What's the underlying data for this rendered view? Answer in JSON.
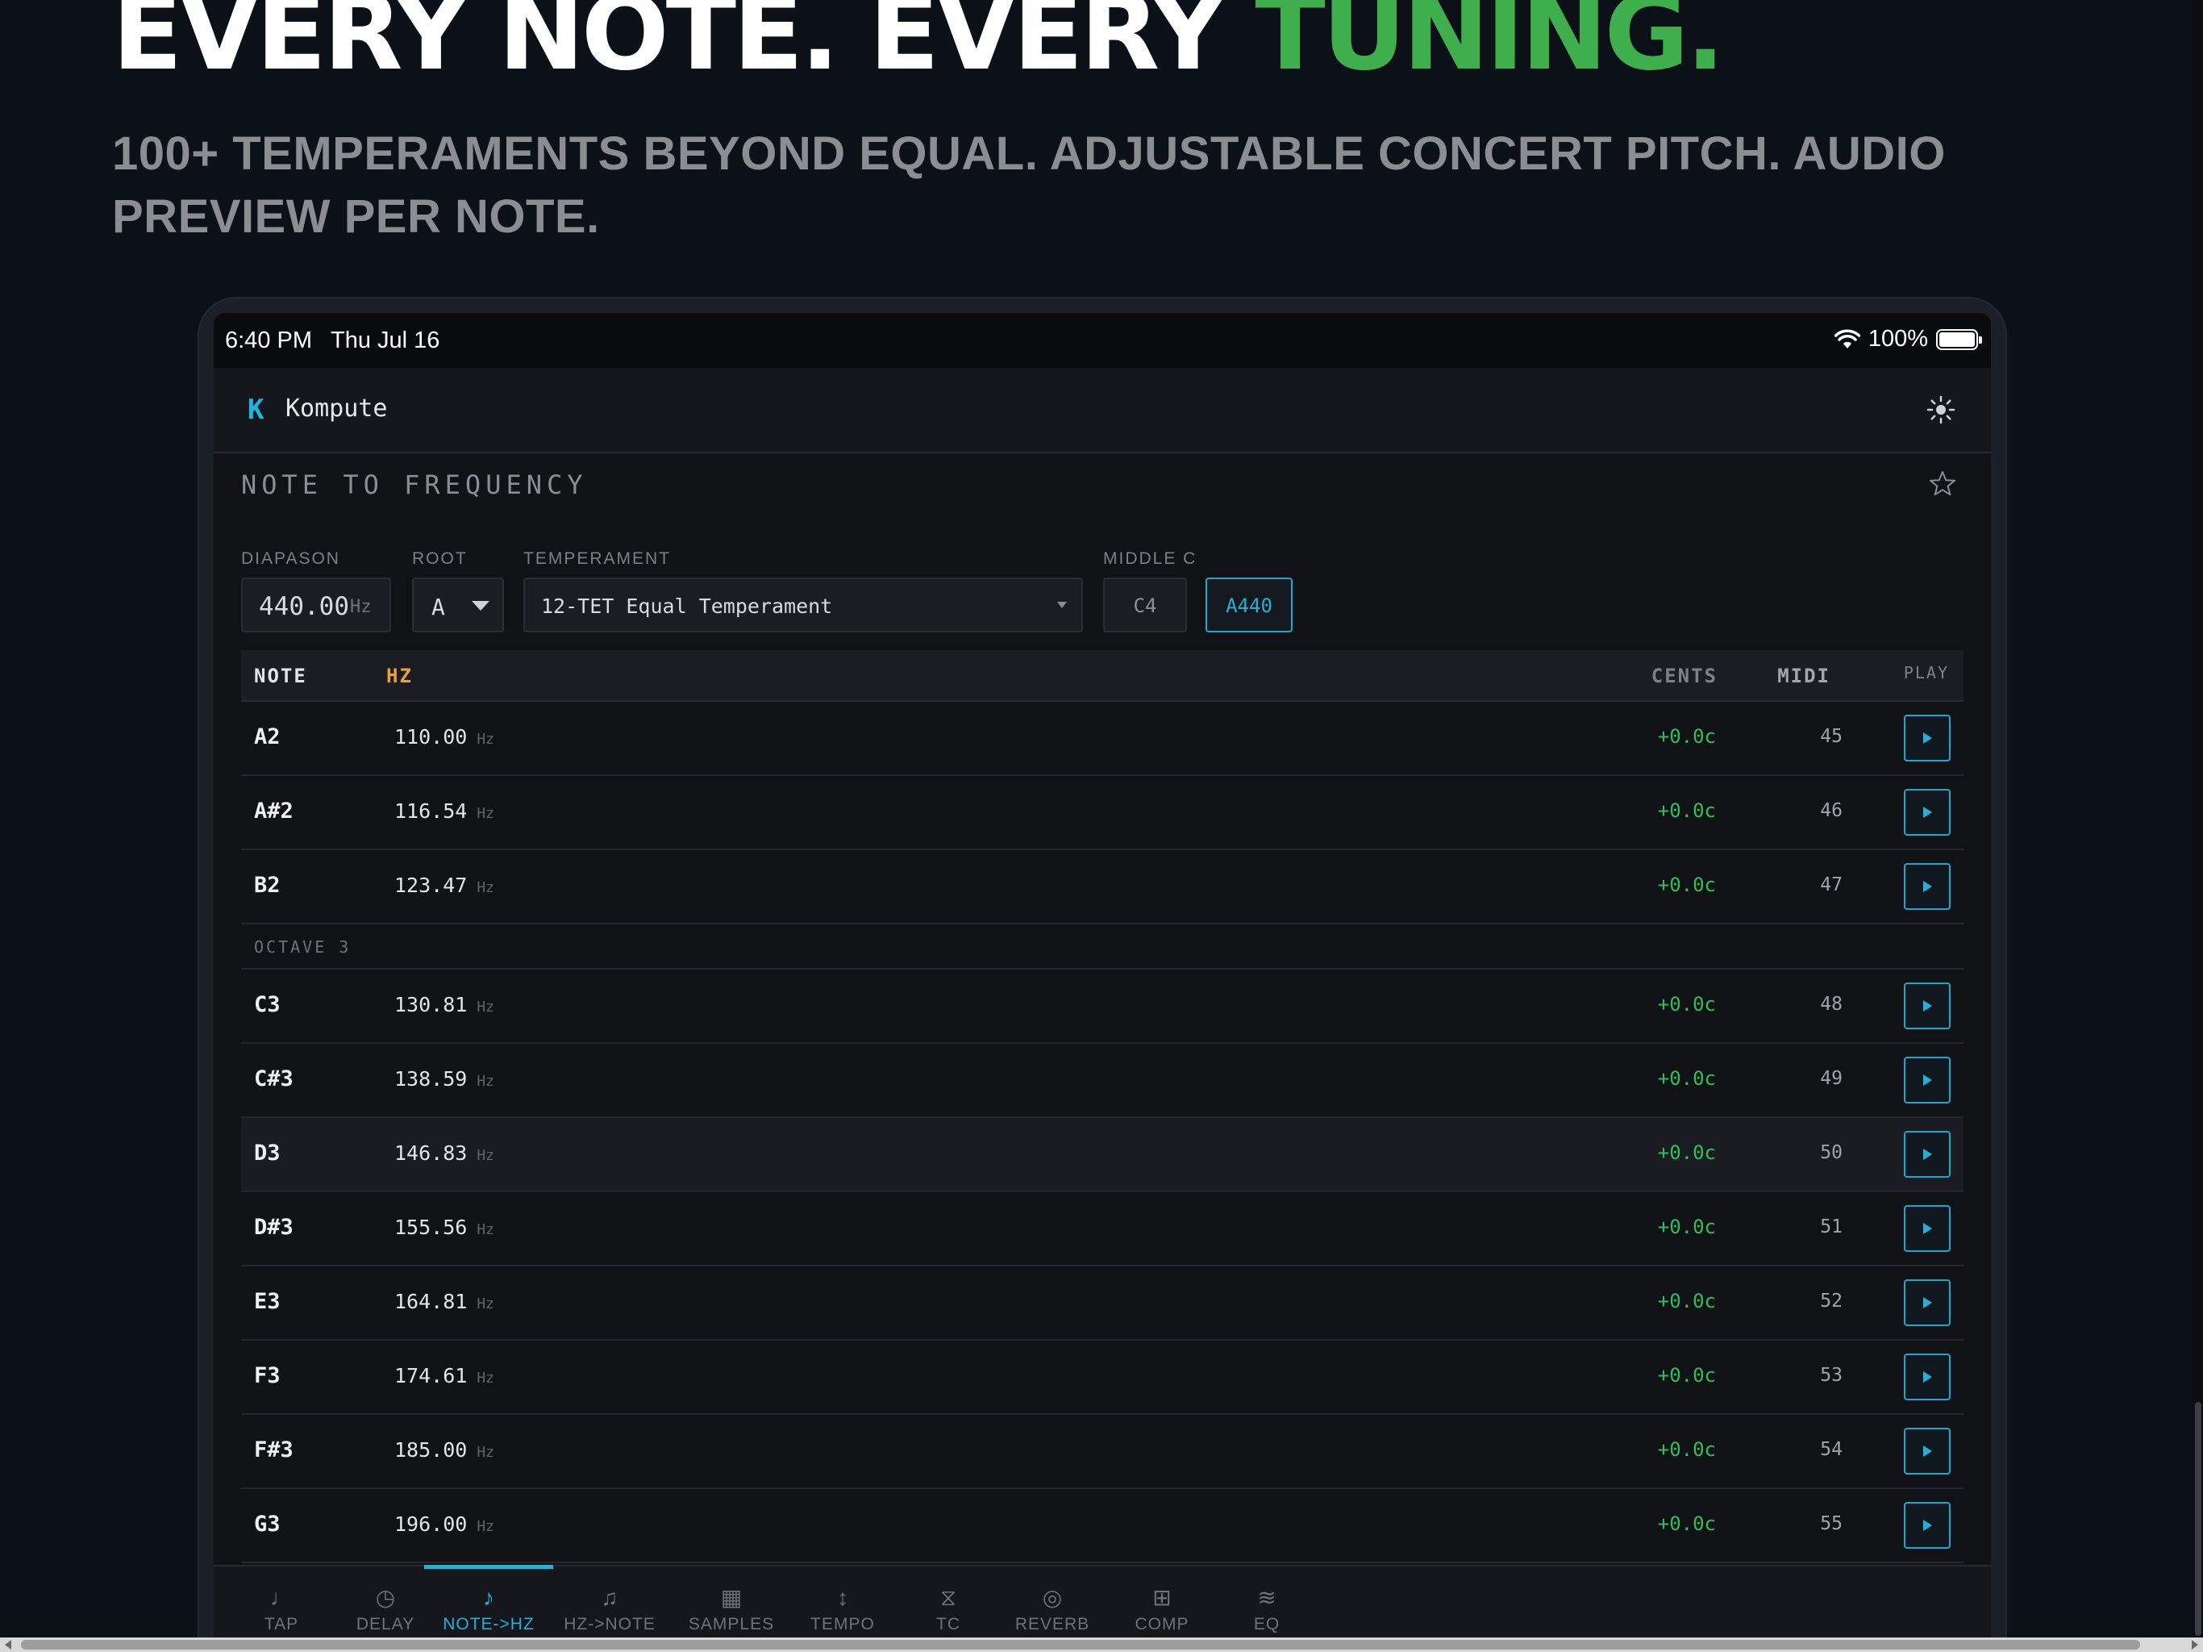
{
  "hero": {
    "title_main": "EVERY NOTE. EVERY ",
    "title_accent": "TUNING.",
    "subtitle": "100+ TEMPERAMENTS BEYOND EQUAL. ADJUSTABLE CONCERT PITCH. AUDIO PREVIEW PER NOTE."
  },
  "status": {
    "time": "6:40 PM",
    "date": "Thu Jul 16",
    "battery": "100%"
  },
  "app": {
    "logo": "K",
    "name": "Kompute",
    "theme_icon": "sun-icon"
  },
  "section": {
    "title": "NOTE TO FREQUENCY",
    "favorite_icon": "star-icon"
  },
  "controls": {
    "diapason_label": "DIAPASON",
    "diapason_value": "440.00",
    "diapason_unit": "Hz",
    "root_label": "ROOT",
    "root_value": "A",
    "temperament_label": "TEMPERAMENT",
    "temperament_value": "12-TET Equal Temperament",
    "middle_c_label": "MIDDLE C",
    "middle_c_option": "C4",
    "a440_option": "A440"
  },
  "table": {
    "headers": {
      "note": "NOTE",
      "hz": "HZ",
      "cents": "CENTS",
      "midi": "MIDI",
      "play": "PLAY"
    },
    "unit": "Hz",
    "rows_top": [
      {
        "note": "A2",
        "hz": "110.00",
        "cents": "+0.0c",
        "midi": "45"
      },
      {
        "note": "A#2",
        "hz": "116.54",
        "cents": "+0.0c",
        "midi": "46"
      },
      {
        "note": "B2",
        "hz": "123.47",
        "cents": "+0.0c",
        "midi": "47"
      }
    ],
    "octave_label": "OCTAVE 3",
    "rows_octave": [
      {
        "note": "C3",
        "hz": "130.81",
        "cents": "+0.0c",
        "midi": "48"
      },
      {
        "note": "C#3",
        "hz": "138.59",
        "cents": "+0.0c",
        "midi": "49"
      },
      {
        "note": "D3",
        "hz": "146.83",
        "cents": "+0.0c",
        "midi": "50"
      },
      {
        "note": "D#3",
        "hz": "155.56",
        "cents": "+0.0c",
        "midi": "51"
      },
      {
        "note": "E3",
        "hz": "164.81",
        "cents": "+0.0c",
        "midi": "52"
      },
      {
        "note": "F3",
        "hz": "174.61",
        "cents": "+0.0c",
        "midi": "53"
      },
      {
        "note": "F#3",
        "hz": "185.00",
        "cents": "+0.0c",
        "midi": "54"
      },
      {
        "note": "G3",
        "hz": "196.00",
        "cents": "+0.0c",
        "midi": "55"
      }
    ]
  },
  "tabs": [
    {
      "label": "TAP",
      "icon": "♩"
    },
    {
      "label": "DELAY",
      "icon": "◷"
    },
    {
      "label": "NOTE->HZ",
      "icon": "♪"
    },
    {
      "label": "HZ->NOTE",
      "icon": "♫"
    },
    {
      "label": "SAMPLES",
      "icon": "▦"
    },
    {
      "label": "TEMPO",
      "icon": "↕"
    },
    {
      "label": "TC",
      "icon": "⧖"
    },
    {
      "label": "REVERB",
      "icon": "◎"
    },
    {
      "label": "COMP",
      "icon": "⊞"
    },
    {
      "label": "EQ",
      "icon": "≋"
    }
  ],
  "active_tab": "NOTE->HZ",
  "colors": {
    "accent": "#1fb3d9",
    "hero_accent": "#3fae4c",
    "cents": "#2fbf5a",
    "hz_header": "#e7a33a"
  }
}
